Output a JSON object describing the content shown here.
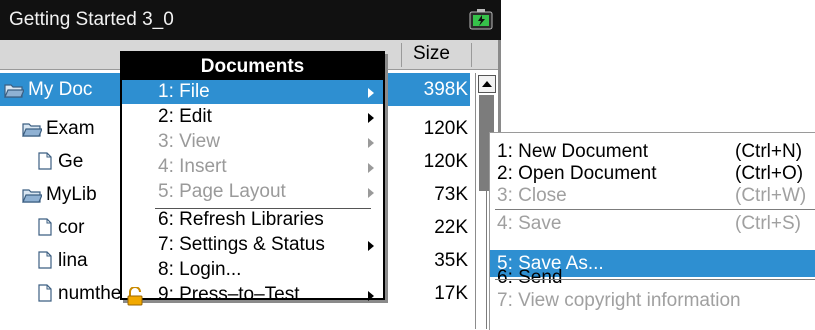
{
  "titlebar": {
    "title": "Getting Started 3_0"
  },
  "columns": {
    "size_label": "Size"
  },
  "files": [
    {
      "name": "My Doc",
      "size": "398K",
      "type": "folder",
      "indent": 0,
      "selected": true
    },
    {
      "name": "Exam",
      "size": "120K",
      "type": "folder",
      "indent": 1
    },
    {
      "name": "Ge",
      "size": "120K",
      "type": "document",
      "indent": 2
    },
    {
      "name": "MyLib",
      "size": "73K",
      "type": "folder",
      "indent": 1
    },
    {
      "name": "cor",
      "size": "22K",
      "type": "document",
      "indent": 2
    },
    {
      "name": "lina",
      "size": "35K",
      "type": "document",
      "indent": 2
    },
    {
      "name": "numtheory",
      "size": "17K",
      "type": "document",
      "indent": 2
    }
  ],
  "documents_menu": {
    "title": "Documents",
    "items": [
      {
        "label": "1: File",
        "submenu": true,
        "active": true
      },
      {
        "label": "2: Edit",
        "submenu": true
      },
      {
        "label": "3: View",
        "submenu": true,
        "disabled": true
      },
      {
        "label": "4: Insert",
        "submenu": true,
        "disabled": true
      },
      {
        "label": "5: Page Layout",
        "submenu": true,
        "disabled": true
      },
      {
        "label": "6: Refresh Libraries"
      },
      {
        "label": "7: Settings & Status",
        "submenu": true
      },
      {
        "label": "8: Login..."
      },
      {
        "label": "9: Press–to–Test",
        "submenu": true,
        "icon": "lock-icon"
      }
    ]
  },
  "file_menu": {
    "items": [
      {
        "label": "1: New Document",
        "shortcut": "(Ctrl+N)"
      },
      {
        "label": "2: Open Document",
        "shortcut": "(Ctrl+O)"
      },
      {
        "label": "3: Close",
        "shortcut": "(Ctrl+W)",
        "disabled": true
      },
      {
        "label": "4: Save",
        "shortcut": "(Ctrl+S)",
        "disabled": true
      },
      {
        "label": "5: Save As...",
        "shortcut": "",
        "active": true
      },
      {
        "label": "6: Send",
        "shortcut": ""
      },
      {
        "label": "7: View copyright information",
        "shortcut": "",
        "disabled": true
      }
    ]
  },
  "colors": {
    "selection": "#2e8fd1",
    "titlebar": "#111111",
    "header": "#d7d7d7",
    "disabled": "#9a9a9a"
  }
}
